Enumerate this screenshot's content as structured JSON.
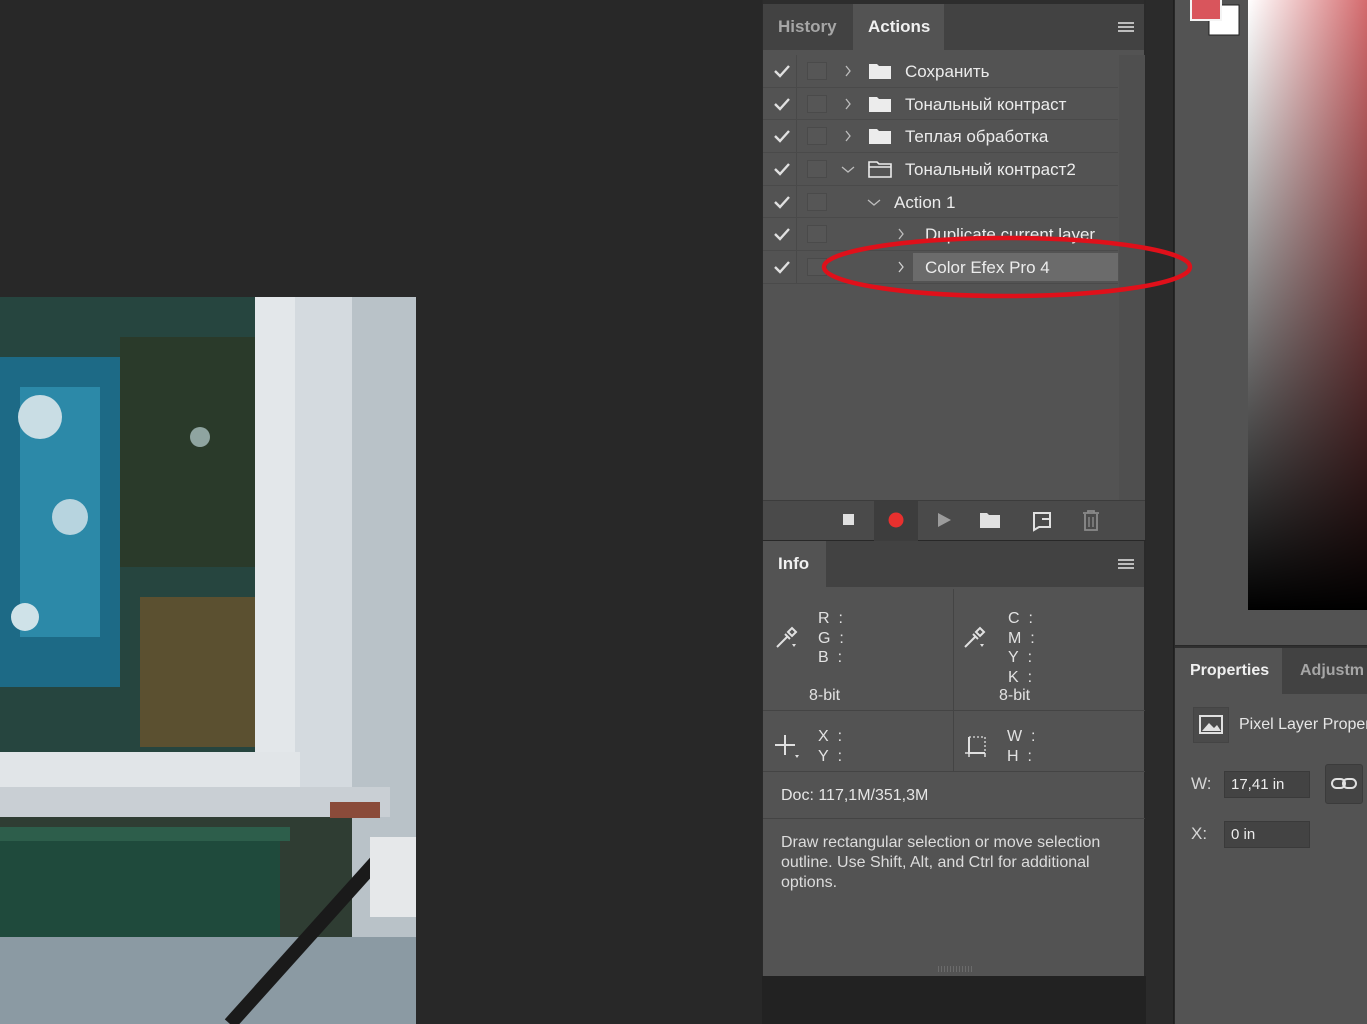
{
  "actions_panel": {
    "tabs": [
      {
        "label": "History",
        "active": false
      },
      {
        "label": "Actions",
        "active": true
      }
    ],
    "items": [
      {
        "label": "Сохранить",
        "type": "set",
        "expanded": false
      },
      {
        "label": "Тональный контраст",
        "type": "set",
        "expanded": false
      },
      {
        "label": "Теплая обработка",
        "type": "set",
        "expanded": false
      },
      {
        "label": "Тональный контраст2",
        "type": "set",
        "expanded": true
      },
      {
        "label": "Action 1",
        "type": "action",
        "expanded": true
      },
      {
        "label": "Duplicate current layer",
        "type": "step",
        "expanded": false
      },
      {
        "label": "Color Efex Pro 4",
        "type": "step",
        "expanded": false,
        "selected": true
      }
    ],
    "toolbar": [
      "stop-icon",
      "record-icon",
      "play-icon",
      "new-set-icon",
      "new-action-icon",
      "delete-icon"
    ],
    "record_color": "#e8302e"
  },
  "info_panel": {
    "tab": "Info",
    "rgb_labels": [
      "R",
      "G",
      "B"
    ],
    "cmyk_labels": [
      "C",
      "M",
      "Y",
      "K"
    ],
    "bit_depth_left": "8-bit",
    "bit_depth_right": "8-bit",
    "xy_labels": [
      "X",
      "Y"
    ],
    "wh_labels": [
      "W",
      "H"
    ],
    "doc": "Doc: 117,1M/351,3M",
    "hint": "Draw rectangular selection or move selection outline.  Use Shift, Alt, and Ctrl for additional options."
  },
  "color_panel": {
    "foreground": "#d9555c",
    "background": "#ffffff"
  },
  "properties_panel": {
    "tabs": [
      {
        "label": "Properties",
        "active": true
      },
      {
        "label": "Adjustm",
        "active": false
      }
    ],
    "layer_type": "Pixel Layer Proper",
    "w_label": "W:",
    "w_value": "17,41 in",
    "x_label": "X:",
    "x_value": "0 in"
  },
  "annotation_color": "#e0101a"
}
